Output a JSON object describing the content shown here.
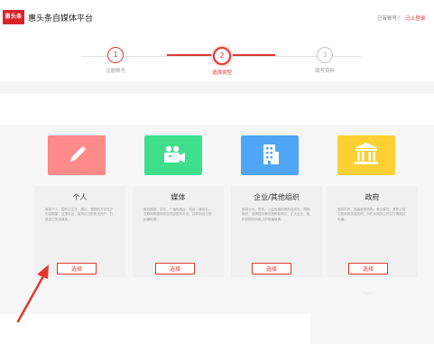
{
  "header": {
    "logo_text": "惠头条",
    "title": "惠头条自媒体平台",
    "account_prompt": "已有账号？",
    "login_link": "马上登录"
  },
  "steps": [
    {
      "number": "1",
      "label": "注册账号",
      "state": "done"
    },
    {
      "number": "2",
      "label": "选择类型",
      "state": "active"
    },
    {
      "number": "3",
      "label": "填写资料",
      "state": "pending"
    }
  ],
  "cards": [
    {
      "name": "个人",
      "icon": "pencil-icon",
      "color": "#fe8a8a",
      "desc": "面向个人，擅长以文字、图片、视频的方式生产内容期望，互惠平台，保持自己的粉丝用户，打造自己的自媒体。",
      "button": "选择"
    },
    {
      "name": "媒体",
      "icon": "video-camera-icon",
      "color": "#3fde8c",
      "desc": "面向报纸、杂志、广播电视台、电台、通讯社、互联网等媒体开放内容发布平台，并拿到自己的运营权限。",
      "button": "选择"
    },
    {
      "name": "企业/其他组织",
      "icon": "building-icon",
      "color": "#4ea6f4",
      "desc": "面向企业、机构、公益性组织等内容发布，帮助组织、品牌提升曝光度和影响力，扩大企业、组织机构在网络上的传播效果。",
      "button": "选择"
    },
    {
      "name": "政府",
      "icon": "government-building-icon",
      "color": "#fdd033",
      "desc": "面向中央、各级政府机构、事业单位，具有公信力的政务信息发布，为扩大政务公开并打通政民沟通。",
      "button": "选择"
    }
  ],
  "colors": {
    "accent": "#e3372f"
  }
}
